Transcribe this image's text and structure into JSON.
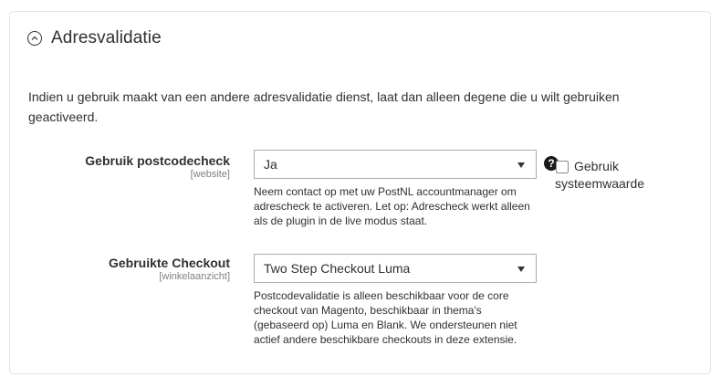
{
  "section": {
    "title": "Adresvalidatie",
    "intro": "Indien u gebruik maakt van een andere adresvalidatie dienst, laat dan alleen degene die u wilt gebruiken geactiveerd."
  },
  "fields": [
    {
      "label": "Gebruik postcodecheck",
      "scope": "[website]",
      "value": "Ja",
      "note": "Neem contact op met uw PostNL accountmanager om adrescheck te activeren. Let op: Adrescheck werkt alleen als de plugin in de live modus staat.",
      "help_icon": "?",
      "use_system_value_label": "Gebruik systeemwaarde"
    },
    {
      "label": "Gebruikte Checkout",
      "scope": "[winkelaanzicht]",
      "value": "Two Step Checkout Luma",
      "note": "Postcodevalidatie is alleen beschikbaar voor de core checkout van Magento, beschikbaar in thema's (gebaseerd op) Luma en Blank. We ondersteunen niet actief andere beschikbare checkouts in deze extensie."
    }
  ],
  "icons": {
    "collapse": "chevron-up-circle-icon",
    "help": "question-circle-icon",
    "dropdown": "caret-down-icon"
  }
}
